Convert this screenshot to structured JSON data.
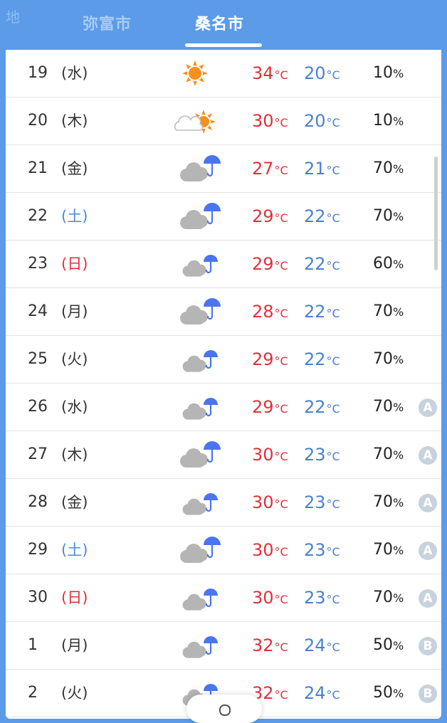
{
  "header": {
    "corner_label": "地",
    "tabs": [
      {
        "label": "弥富市",
        "selected": false
      },
      {
        "label": "桑名市",
        "selected": true
      }
    ]
  },
  "colors": {
    "header_bg": "#5b9be8",
    "high_temp": "#e0313a",
    "low_temp": "#4a80d0",
    "saturday": "#4a88de",
    "sunday": "#e0313a",
    "sun": "#f5901e",
    "umbrella": "#4b74f0",
    "cloud": "#b5b5b5"
  },
  "forecast": [
    {
      "date": "19",
      "dow": "(水)",
      "icon": "sunny-icon",
      "high": "34",
      "low": "20",
      "pop": "10",
      "rank": ""
    },
    {
      "date": "20",
      "dow": "(木)",
      "icon": "cloud-sun-icon",
      "high": "30",
      "low": "20",
      "pop": "10",
      "rank": ""
    },
    {
      "date": "21",
      "dow": "(金)",
      "icon": "cloud-rain-icon",
      "high": "27",
      "low": "21",
      "pop": "70",
      "rank": ""
    },
    {
      "date": "22",
      "dow": "(土)",
      "icon": "cloud-rain-icon",
      "high": "29",
      "low": "22",
      "pop": "70",
      "rank": ""
    },
    {
      "date": "23",
      "dow": "(日)",
      "icon": "cloud-rain-small-icon",
      "high": "29",
      "low": "22",
      "pop": "60",
      "rank": ""
    },
    {
      "date": "24",
      "dow": "(月)",
      "icon": "cloud-rain-icon",
      "high": "28",
      "low": "22",
      "pop": "70",
      "rank": ""
    },
    {
      "date": "25",
      "dow": "(火)",
      "icon": "cloud-rain-small-icon",
      "high": "29",
      "low": "22",
      "pop": "70",
      "rank": ""
    },
    {
      "date": "26",
      "dow": "(水)",
      "icon": "cloud-rain-small-icon",
      "high": "29",
      "low": "22",
      "pop": "70",
      "rank": "A"
    },
    {
      "date": "27",
      "dow": "(木)",
      "icon": "cloud-rain-icon",
      "high": "30",
      "low": "23",
      "pop": "70",
      "rank": "A"
    },
    {
      "date": "28",
      "dow": "(金)",
      "icon": "cloud-rain-small-icon",
      "high": "30",
      "low": "23",
      "pop": "70",
      "rank": "A"
    },
    {
      "date": "29",
      "dow": "(土)",
      "icon": "cloud-rain-icon",
      "high": "30",
      "low": "23",
      "pop": "70",
      "rank": "A"
    },
    {
      "date": "30",
      "dow": "(日)",
      "icon": "cloud-rain-small-icon",
      "high": "30",
      "low": "23",
      "pop": "70",
      "rank": "A"
    },
    {
      "date": "1",
      "dow": "(月)",
      "icon": "cloud-rain-small-icon",
      "high": "32",
      "low": "24",
      "pop": "50",
      "rank": "B"
    },
    {
      "date": "2",
      "dow": "(火)",
      "icon": "cloud-rain-small-icon",
      "high": "32",
      "low": "24",
      "pop": "50",
      "rank": "B"
    }
  ],
  "units": {
    "temp": "°C",
    "pop": "%"
  }
}
